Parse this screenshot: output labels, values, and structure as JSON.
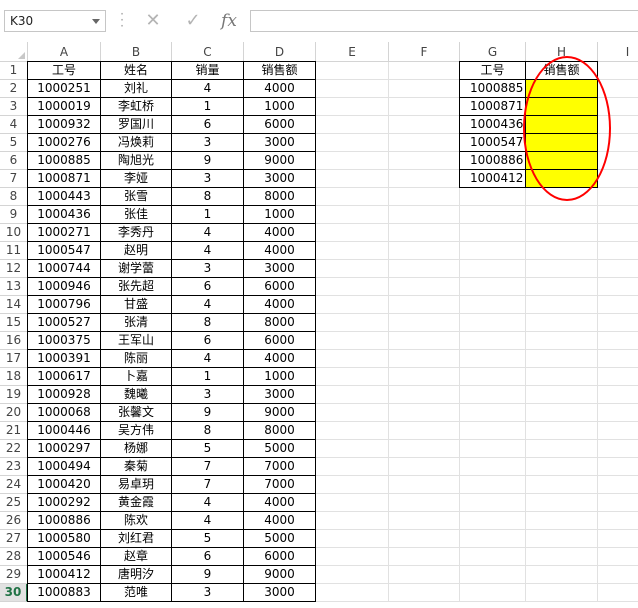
{
  "name_box": {
    "value": "K30"
  },
  "formula_bar": {
    "cancel_icon": "close-icon",
    "enter_icon": "check-icon",
    "fx_label": "fx",
    "value": ""
  },
  "columns": [
    "A",
    "B",
    "C",
    "D",
    "E",
    "F",
    "G",
    "H",
    "I"
  ],
  "rows": [
    "1",
    "2",
    "3",
    "4",
    "5",
    "6",
    "7",
    "8",
    "9",
    "10",
    "11",
    "12",
    "13",
    "14",
    "15",
    "16",
    "17",
    "18",
    "19",
    "20",
    "21",
    "22",
    "23",
    "24",
    "25",
    "26",
    "27",
    "28",
    "29",
    "30"
  ],
  "active_row": "30",
  "main_table": {
    "headers": [
      "工号",
      "姓名",
      "销量",
      "销售额"
    ],
    "rows": [
      [
        "1000251",
        "刘礼",
        "4",
        "4000"
      ],
      [
        "1000019",
        "李虹桥",
        "1",
        "1000"
      ],
      [
        "1000932",
        "罗国川",
        "6",
        "6000"
      ],
      [
        "1000276",
        "冯焕莉",
        "3",
        "3000"
      ],
      [
        "1000885",
        "陶旭光",
        "9",
        "9000"
      ],
      [
        "1000871",
        "李娅",
        "3",
        "3000"
      ],
      [
        "1000443",
        "张雪",
        "8",
        "8000"
      ],
      [
        "1000436",
        "张佳",
        "1",
        "1000"
      ],
      [
        "1000271",
        "李秀丹",
        "4",
        "4000"
      ],
      [
        "1000547",
        "赵明",
        "4",
        "4000"
      ],
      [
        "1000744",
        "谢学蕾",
        "3",
        "3000"
      ],
      [
        "1000946",
        "张先超",
        "6",
        "6000"
      ],
      [
        "1000796",
        "甘盛",
        "4",
        "4000"
      ],
      [
        "1000527",
        "张清",
        "8",
        "8000"
      ],
      [
        "1000375",
        "王军山",
        "6",
        "6000"
      ],
      [
        "1000391",
        "陈丽",
        "4",
        "4000"
      ],
      [
        "1000617",
        "卜嘉",
        "1",
        "1000"
      ],
      [
        "1000928",
        "魏曦",
        "3",
        "3000"
      ],
      [
        "1000068",
        "张馨文",
        "9",
        "9000"
      ],
      [
        "1000446",
        "吴方伟",
        "8",
        "8000"
      ],
      [
        "1000297",
        "杨娜",
        "5",
        "5000"
      ],
      [
        "1000494",
        "秦菊",
        "7",
        "7000"
      ],
      [
        "1000420",
        "易卓玥",
        "7",
        "7000"
      ],
      [
        "1000292",
        "黄金霞",
        "4",
        "4000"
      ],
      [
        "1000886",
        "陈欢",
        "4",
        "4000"
      ],
      [
        "1000580",
        "刘红君",
        "5",
        "5000"
      ],
      [
        "1000546",
        "赵章",
        "6",
        "6000"
      ],
      [
        "1000412",
        "唐明汐",
        "9",
        "9000"
      ],
      [
        "1000883",
        "范唯",
        "3",
        "3000"
      ]
    ]
  },
  "lookup_table": {
    "headers": [
      "工号",
      "销售额"
    ],
    "ids": [
      "1000885",
      "1000871",
      "1000436",
      "1000547",
      "1000886",
      "1000412"
    ],
    "fill_color": "#ffff00",
    "highlight_color": "#ff0000"
  }
}
